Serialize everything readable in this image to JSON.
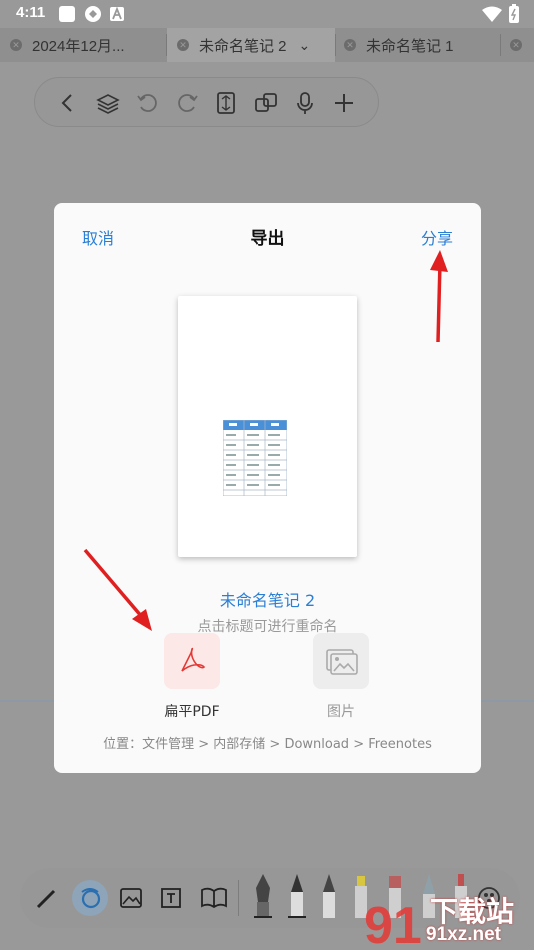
{
  "status_bar": {
    "time": "4:11"
  },
  "tabs": [
    {
      "label": "2024年12月..."
    },
    {
      "label": "未命名笔记 2"
    },
    {
      "label": "未命名笔记 1"
    }
  ],
  "dialog": {
    "cancel_label": "取消",
    "title": "导出",
    "share_label": "分享",
    "note_name": "未命名笔记 2",
    "rename_hint": "点击标题可进行重命名",
    "options": [
      {
        "label": "扁平PDF",
        "icon": "pdf-icon",
        "color": "#e53935"
      },
      {
        "label": "图片",
        "icon": "image-icon"
      }
    ],
    "path": "位置：文件管理 > 内部存储 > Download > Freenotes"
  },
  "watermark": {
    "text": "下载站",
    "url_text": "91xz.net",
    "number": "91"
  }
}
